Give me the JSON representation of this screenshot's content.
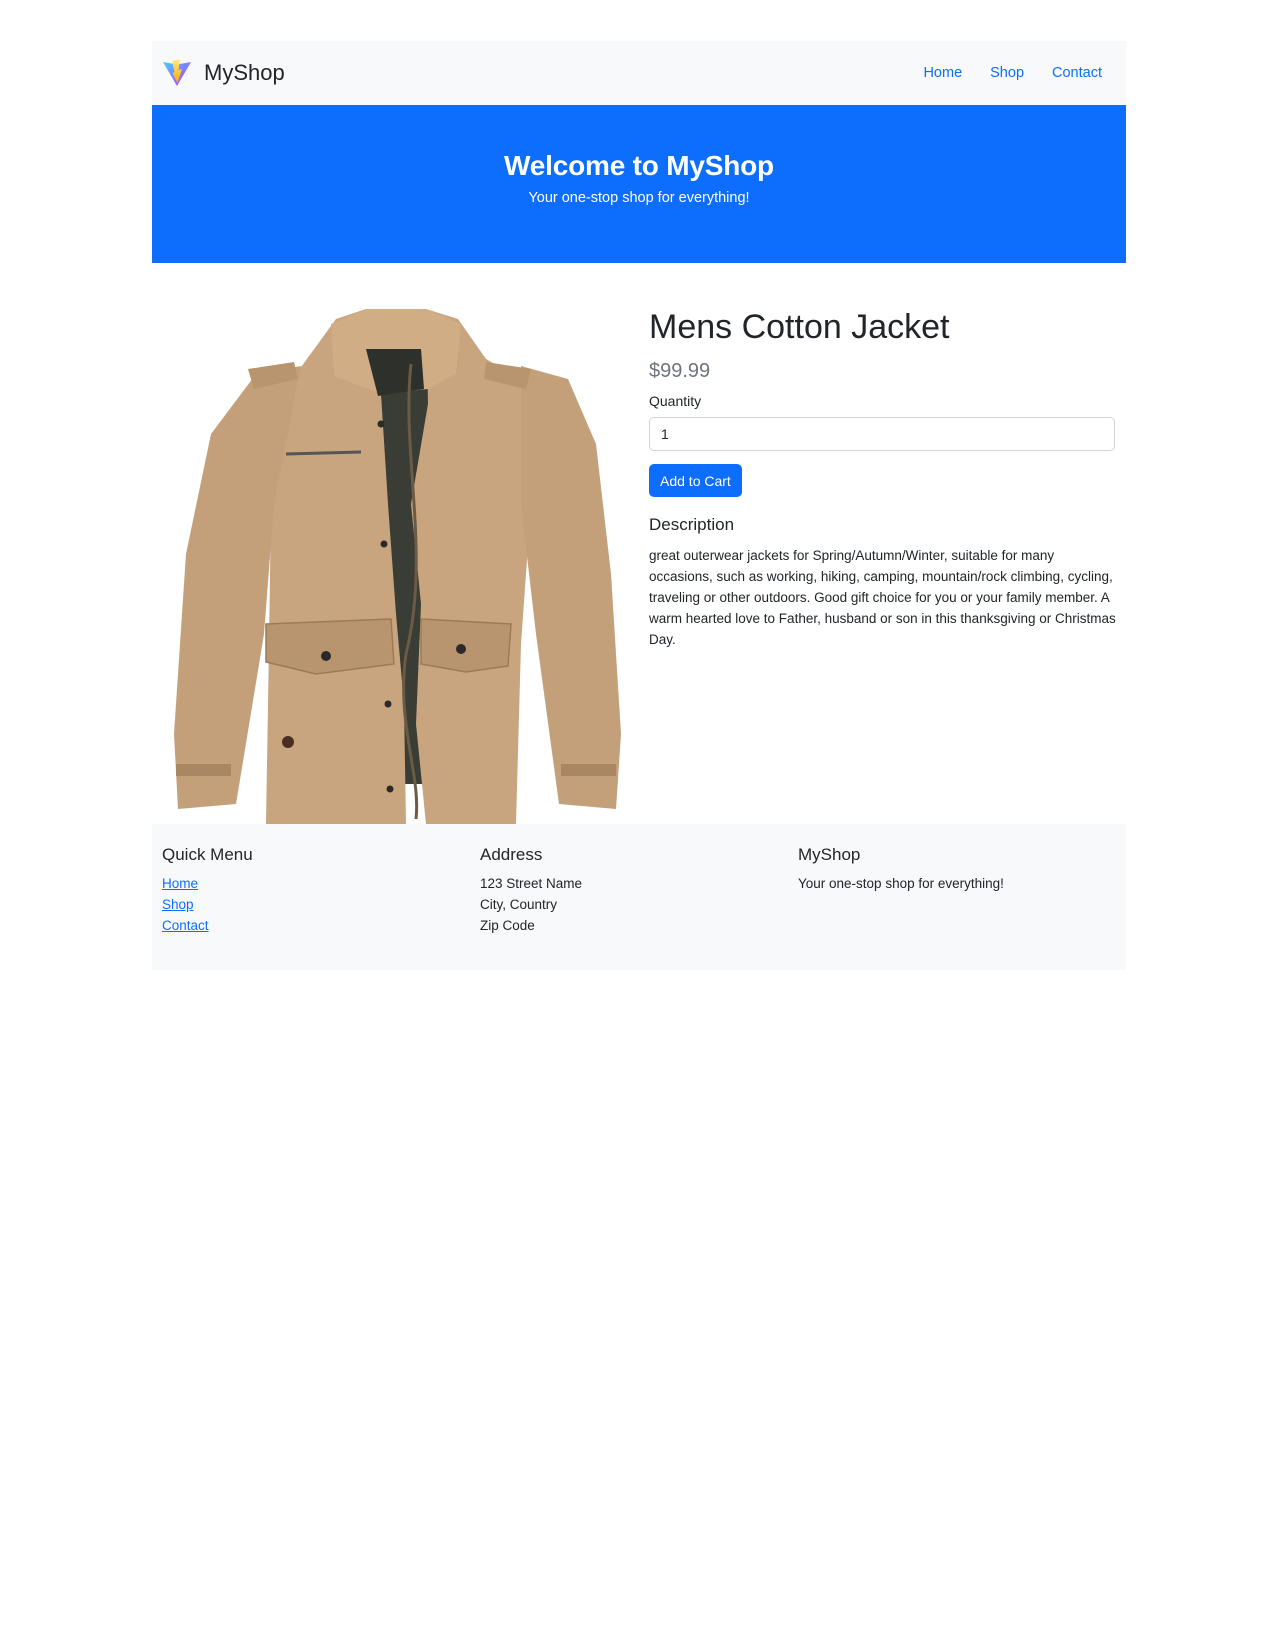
{
  "navbar": {
    "brand": "MyShop",
    "logo_icon": "vite-logo-icon",
    "links": [
      "Home",
      "Shop",
      "Contact"
    ]
  },
  "hero": {
    "title": "Welcome to MyShop",
    "subtitle": "Your one-stop shop for everything!"
  },
  "product": {
    "image_icon": "jacket-product-image",
    "title": "Mens Cotton Jacket",
    "price": "$99.99",
    "quantity_label": "Quantity",
    "quantity_value": "1",
    "add_to_cart_label": "Add to Cart",
    "description_heading": "Description",
    "description": "great outerwear jackets for Spring/Autumn/Winter, suitable for many occasions, such as working, hiking, camping, mountain/rock climbing, cycling, traveling or other outdoors. Good gift choice for you or your family member. A warm hearted love to Father, husband or son in this thanksgiving or Christmas Day."
  },
  "footer": {
    "quick_menu": {
      "heading": "Quick Menu",
      "links": [
        "Home",
        "Shop",
        "Contact"
      ]
    },
    "address": {
      "heading": "Address",
      "lines": [
        "123 Street Name",
        "City, Country",
        "Zip Code"
      ]
    },
    "about": {
      "heading": "MyShop",
      "text": "Your one-stop shop for everything!"
    }
  },
  "colors": {
    "primary": "#0d6efd",
    "light_bg": "#f8f9fa",
    "jacket": "#c8a57e",
    "jacket_lining": "#3a3d36"
  }
}
